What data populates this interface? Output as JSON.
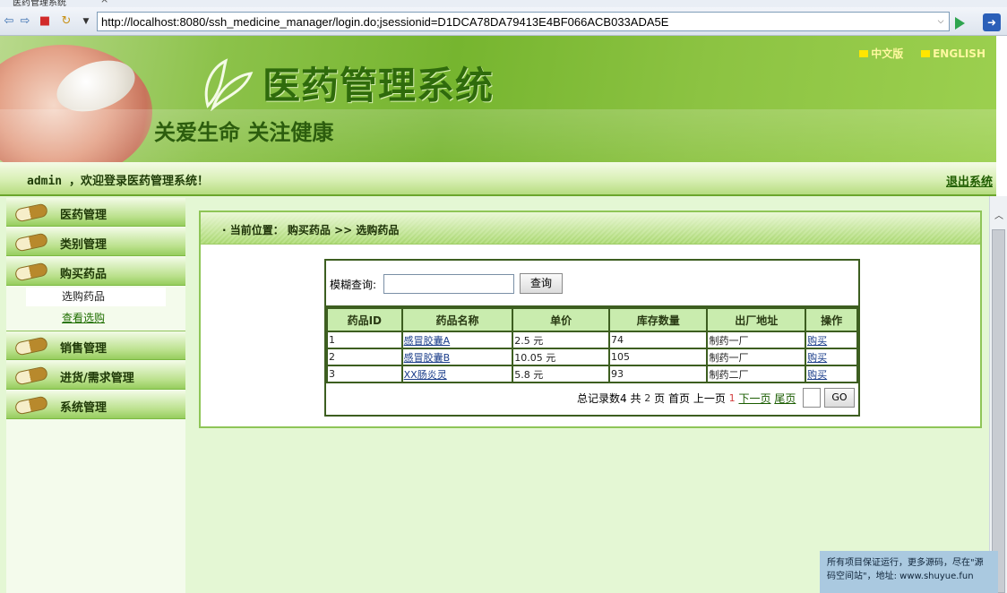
{
  "browser": {
    "tab_title": "医药管理系统",
    "url": "http://localhost:8080/ssh_medicine_manager/login.do;jsessionid=D1DCA78DA79413E4BF066ACB033ADA5E"
  },
  "banner": {
    "title": "医药管理系统",
    "slogan": "关爱生命  关注健康",
    "lang_cn": "中文版",
    "lang_en": "ENGLISH"
  },
  "welcome": {
    "text": "admin ，欢迎登录医药管理系统！",
    "logout": "退出系统"
  },
  "sidebar": {
    "menus": [
      {
        "label": "医药管理"
      },
      {
        "label": "类别管理"
      },
      {
        "label": "购买药品"
      },
      {
        "label": "销售管理"
      },
      {
        "label": "进货/需求管理"
      },
      {
        "label": "系统管理"
      }
    ],
    "sub_items": [
      {
        "label": "选购药品"
      },
      {
        "label": "查看选购"
      }
    ]
  },
  "main": {
    "breadcrumb": "· 当前位置： 购买药品 >> 选购药品",
    "search_label": "模糊查询:",
    "search_value": "",
    "search_button": "查询",
    "columns": [
      "药品ID",
      "药品名称",
      "单价",
      "库存数量",
      "出厂地址",
      "操作"
    ],
    "rows": [
      {
        "id": "1",
        "name": "感冒胶囊A",
        "price": "2.5 元",
        "stock": "74",
        "factory": "制药一厂",
        "action": "购买"
      },
      {
        "id": "2",
        "name": "感冒胶囊B",
        "price": "10.05 元",
        "stock": "105",
        "factory": "制药一厂",
        "action": "购买"
      },
      {
        "id": "3",
        "name": "XX肠炎灵",
        "price": "5.8 元",
        "stock": "93",
        "factory": "制药二厂",
        "action": "购买"
      }
    ],
    "pager": {
      "total_label": "总记录数4",
      "pages_prefix": "共",
      "pages_count": "2",
      "pages_suffix": "页",
      "first": "首页",
      "prev": "上一页",
      "current": "1",
      "next": "下一页",
      "last": "尾页",
      "page_input": "",
      "go": "GO"
    }
  },
  "notice": "所有项目保证运行，更多源码，尽在\"源码空间站\"，地址: www.shuyue.fun"
}
